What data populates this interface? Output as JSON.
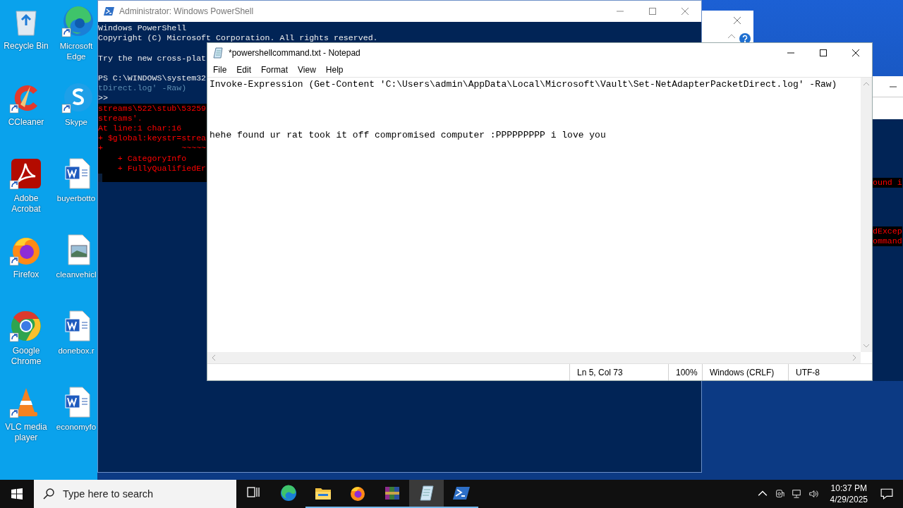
{
  "desktop_icons": [
    {
      "label": "Recycle Bin",
      "kind": "recycle",
      "shortcut": false
    },
    {
      "label": "Microsoft Edge",
      "kind": "edge",
      "shortcut": true
    },
    {
      "label": "CCleaner",
      "kind": "ccleaner",
      "shortcut": true
    },
    {
      "label": "Skype",
      "kind": "skype",
      "shortcut": true
    },
    {
      "label": "Adobe Acrobat",
      "kind": "acrobat",
      "shortcut": true
    },
    {
      "label": "buyerbotto",
      "kind": "word",
      "shortcut": false
    },
    {
      "label": "Firefox",
      "kind": "firefox",
      "shortcut": true
    },
    {
      "label": "cleanvehicl",
      "kind": "image",
      "shortcut": false
    },
    {
      "label": "Google Chrome",
      "kind": "chrome",
      "shortcut": true
    },
    {
      "label": "donebox.r",
      "kind": "word",
      "shortcut": false
    },
    {
      "label": "VLC media player",
      "kind": "vlc",
      "shortcut": true
    },
    {
      "label": "economyfo",
      "kind": "word",
      "shortcut": false
    }
  ],
  "powershell": {
    "title": "Administrator: Windows PowerShell",
    "blocks": [
      {
        "lines": [
          {
            "text": "Windows PowerShell",
            "kind": "normal"
          },
          {
            "text": "Copyright (C) Microsoft Corporation. All rights reserved.",
            "kind": "normal"
          }
        ]
      },
      {
        "lines": [
          {
            "text": "Try the new cross-plat",
            "kind": "normal"
          }
        ]
      },
      {
        "lines": [
          {
            "text": "PS C:\\WINDOWS\\system32",
            "kind": "normal"
          },
          {
            "text": "tDirect.log' -Raw)",
            "kind": "dim"
          },
          {
            "text": ">>",
            "kind": "normal"
          },
          {
            "text": "streams\\522\\stub\\53259",
            "kind": "error"
          },
          {
            "text": "streams'.",
            "kind": "error"
          },
          {
            "text": "At line:1 char:16",
            "kind": "error"
          },
          {
            "text": "+ $global:keystr=strea",
            "kind": "error"
          },
          {
            "text": "+                ~~~~~",
            "kind": "error"
          },
          {
            "text": "    + CategoryInfo",
            "kind": "error"
          },
          {
            "text": "    + FullyQualifiedEr",
            "kind": "error"
          }
        ]
      }
    ]
  },
  "second_console": {
    "lines": [
      "ound i",
      "dExcep",
      "ommand"
    ]
  },
  "notepad": {
    "title": "*powershellcommand.txt - Notepad",
    "menu": [
      "File",
      "Edit",
      "Format",
      "View",
      "Help"
    ],
    "content": "Invoke-Expression (Get-Content 'C:\\Users\\admin\\AppData\\Local\\Microsoft\\Vault\\Set-NetAdapterPacketDirect.log' -Raw)\n\n\n\nhehe found ur rat took it off compromised computer :PPPPPPPPP i love you",
    "status": [
      "Ln 5, Col 73",
      "100%",
      "Windows (CRLF)",
      "UTF-8"
    ]
  },
  "taskbar": {
    "search_placeholder": "Type here to search",
    "apps": [
      {
        "kind": "taskview",
        "running": false,
        "selected": false
      },
      {
        "kind": "edge",
        "running": false,
        "selected": false
      },
      {
        "kind": "explorer",
        "running": true,
        "selected": false
      },
      {
        "kind": "firefox",
        "running": true,
        "selected": false
      },
      {
        "kind": "winrar",
        "running": true,
        "selected": false
      },
      {
        "kind": "notepad",
        "running": true,
        "selected": true
      },
      {
        "kind": "powershell",
        "running": true,
        "selected": false
      }
    ],
    "time": "10:37 PM",
    "date": "4/29/2025"
  }
}
